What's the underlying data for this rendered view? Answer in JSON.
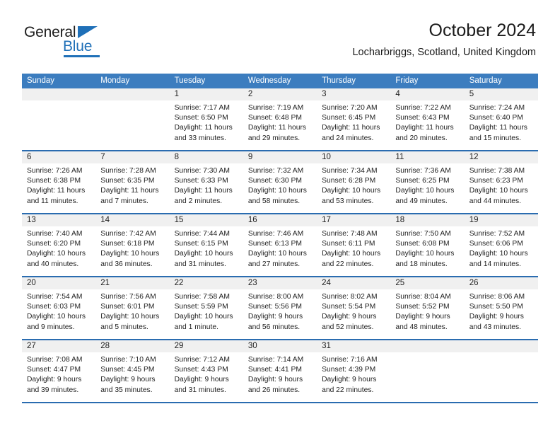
{
  "brand": {
    "name_top": "General",
    "name_bottom": "Blue",
    "logo_icon": "triangle-logo-icon",
    "accent_color": "#1f70b8"
  },
  "header": {
    "title": "October 2024",
    "subtitle": "Locharbriggs, Scotland, United Kingdom"
  },
  "calendar": {
    "header_color": "#3c7dbf",
    "grid_line_color": "#2a6cb0",
    "day_band_color": "#f0f0f0",
    "weekdays": [
      "Sunday",
      "Monday",
      "Tuesday",
      "Wednesday",
      "Thursday",
      "Friday",
      "Saturday"
    ],
    "weeks": [
      [
        {
          "day": "",
          "lines": []
        },
        {
          "day": "",
          "lines": []
        },
        {
          "day": "1",
          "lines": [
            "Sunrise: 7:17 AM",
            "Sunset: 6:50 PM",
            "Daylight: 11 hours",
            "and 33 minutes."
          ]
        },
        {
          "day": "2",
          "lines": [
            "Sunrise: 7:19 AM",
            "Sunset: 6:48 PM",
            "Daylight: 11 hours",
            "and 29 minutes."
          ]
        },
        {
          "day": "3",
          "lines": [
            "Sunrise: 7:20 AM",
            "Sunset: 6:45 PM",
            "Daylight: 11 hours",
            "and 24 minutes."
          ]
        },
        {
          "day": "4",
          "lines": [
            "Sunrise: 7:22 AM",
            "Sunset: 6:43 PM",
            "Daylight: 11 hours",
            "and 20 minutes."
          ]
        },
        {
          "day": "5",
          "lines": [
            "Sunrise: 7:24 AM",
            "Sunset: 6:40 PM",
            "Daylight: 11 hours",
            "and 15 minutes."
          ]
        }
      ],
      [
        {
          "day": "6",
          "lines": [
            "Sunrise: 7:26 AM",
            "Sunset: 6:38 PM",
            "Daylight: 11 hours",
            "and 11 minutes."
          ]
        },
        {
          "day": "7",
          "lines": [
            "Sunrise: 7:28 AM",
            "Sunset: 6:35 PM",
            "Daylight: 11 hours",
            "and 7 minutes."
          ]
        },
        {
          "day": "8",
          "lines": [
            "Sunrise: 7:30 AM",
            "Sunset: 6:33 PM",
            "Daylight: 11 hours",
            "and 2 minutes."
          ]
        },
        {
          "day": "9",
          "lines": [
            "Sunrise: 7:32 AM",
            "Sunset: 6:30 PM",
            "Daylight: 10 hours",
            "and 58 minutes."
          ]
        },
        {
          "day": "10",
          "lines": [
            "Sunrise: 7:34 AM",
            "Sunset: 6:28 PM",
            "Daylight: 10 hours",
            "and 53 minutes."
          ]
        },
        {
          "day": "11",
          "lines": [
            "Sunrise: 7:36 AM",
            "Sunset: 6:25 PM",
            "Daylight: 10 hours",
            "and 49 minutes."
          ]
        },
        {
          "day": "12",
          "lines": [
            "Sunrise: 7:38 AM",
            "Sunset: 6:23 PM",
            "Daylight: 10 hours",
            "and 44 minutes."
          ]
        }
      ],
      [
        {
          "day": "13",
          "lines": [
            "Sunrise: 7:40 AM",
            "Sunset: 6:20 PM",
            "Daylight: 10 hours",
            "and 40 minutes."
          ]
        },
        {
          "day": "14",
          "lines": [
            "Sunrise: 7:42 AM",
            "Sunset: 6:18 PM",
            "Daylight: 10 hours",
            "and 36 minutes."
          ]
        },
        {
          "day": "15",
          "lines": [
            "Sunrise: 7:44 AM",
            "Sunset: 6:15 PM",
            "Daylight: 10 hours",
            "and 31 minutes."
          ]
        },
        {
          "day": "16",
          "lines": [
            "Sunrise: 7:46 AM",
            "Sunset: 6:13 PM",
            "Daylight: 10 hours",
            "and 27 minutes."
          ]
        },
        {
          "day": "17",
          "lines": [
            "Sunrise: 7:48 AM",
            "Sunset: 6:11 PM",
            "Daylight: 10 hours",
            "and 22 minutes."
          ]
        },
        {
          "day": "18",
          "lines": [
            "Sunrise: 7:50 AM",
            "Sunset: 6:08 PM",
            "Daylight: 10 hours",
            "and 18 minutes."
          ]
        },
        {
          "day": "19",
          "lines": [
            "Sunrise: 7:52 AM",
            "Sunset: 6:06 PM",
            "Daylight: 10 hours",
            "and 14 minutes."
          ]
        }
      ],
      [
        {
          "day": "20",
          "lines": [
            "Sunrise: 7:54 AM",
            "Sunset: 6:03 PM",
            "Daylight: 10 hours",
            "and 9 minutes."
          ]
        },
        {
          "day": "21",
          "lines": [
            "Sunrise: 7:56 AM",
            "Sunset: 6:01 PM",
            "Daylight: 10 hours",
            "and 5 minutes."
          ]
        },
        {
          "day": "22",
          "lines": [
            "Sunrise: 7:58 AM",
            "Sunset: 5:59 PM",
            "Daylight: 10 hours",
            "and 1 minute."
          ]
        },
        {
          "day": "23",
          "lines": [
            "Sunrise: 8:00 AM",
            "Sunset: 5:56 PM",
            "Daylight: 9 hours",
            "and 56 minutes."
          ]
        },
        {
          "day": "24",
          "lines": [
            "Sunrise: 8:02 AM",
            "Sunset: 5:54 PM",
            "Daylight: 9 hours",
            "and 52 minutes."
          ]
        },
        {
          "day": "25",
          "lines": [
            "Sunrise: 8:04 AM",
            "Sunset: 5:52 PM",
            "Daylight: 9 hours",
            "and 48 minutes."
          ]
        },
        {
          "day": "26",
          "lines": [
            "Sunrise: 8:06 AM",
            "Sunset: 5:50 PM",
            "Daylight: 9 hours",
            "and 43 minutes."
          ]
        }
      ],
      [
        {
          "day": "27",
          "lines": [
            "Sunrise: 7:08 AM",
            "Sunset: 4:47 PM",
            "Daylight: 9 hours",
            "and 39 minutes."
          ]
        },
        {
          "day": "28",
          "lines": [
            "Sunrise: 7:10 AM",
            "Sunset: 4:45 PM",
            "Daylight: 9 hours",
            "and 35 minutes."
          ]
        },
        {
          "day": "29",
          "lines": [
            "Sunrise: 7:12 AM",
            "Sunset: 4:43 PM",
            "Daylight: 9 hours",
            "and 31 minutes."
          ]
        },
        {
          "day": "30",
          "lines": [
            "Sunrise: 7:14 AM",
            "Sunset: 4:41 PM",
            "Daylight: 9 hours",
            "and 26 minutes."
          ]
        },
        {
          "day": "31",
          "lines": [
            "Sunrise: 7:16 AM",
            "Sunset: 4:39 PM",
            "Daylight: 9 hours",
            "and 22 minutes."
          ]
        },
        {
          "day": "",
          "lines": []
        },
        {
          "day": "",
          "lines": []
        }
      ]
    ]
  }
}
